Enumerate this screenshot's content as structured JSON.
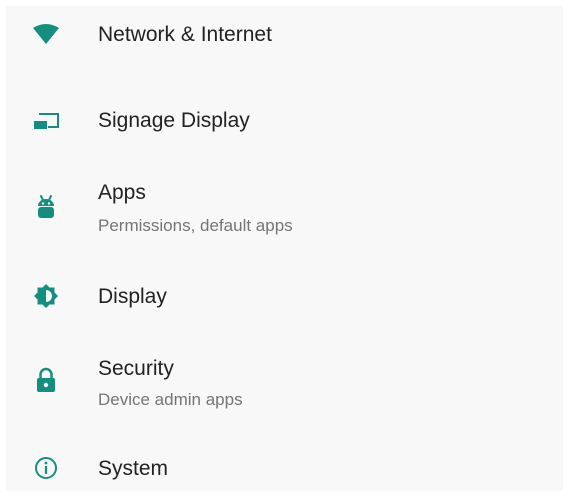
{
  "accent_color": "#148f7f",
  "settings": {
    "items": [
      {
        "icon": "wifi-icon",
        "title": "Network & Internet",
        "subtitle": ""
      },
      {
        "icon": "signage-display-icon",
        "title": "Signage Display",
        "subtitle": ""
      },
      {
        "icon": "android-icon",
        "title": "Apps",
        "subtitle": "Permissions, default apps"
      },
      {
        "icon": "brightness-icon",
        "title": "Display",
        "subtitle": ""
      },
      {
        "icon": "lock-icon",
        "title": "Security",
        "subtitle": "Device admin apps"
      },
      {
        "icon": "info-icon",
        "title": "System",
        "subtitle": ""
      }
    ]
  }
}
